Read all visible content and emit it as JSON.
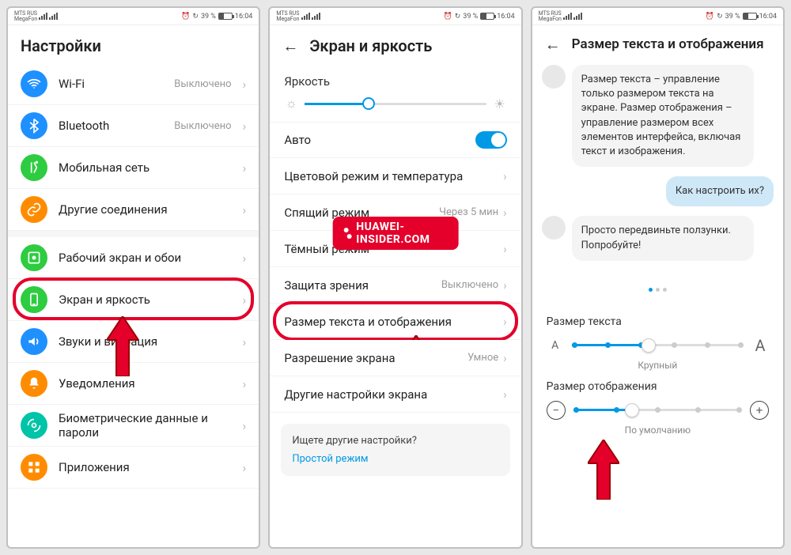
{
  "statusbar": {
    "carrier1": "MTS RUS",
    "carrier2": "MegaFon",
    "alarm": "⏰",
    "battery_pct": "39 %",
    "time": "16:04"
  },
  "watermark": "HUAWEI-INSIDER.COM",
  "screen1": {
    "title": "Настройки",
    "rows": [
      {
        "icon_color": "#1e90ff",
        "glyph": "wifi",
        "label": "Wi-Fi",
        "value": "Выключено"
      },
      {
        "icon_color": "#1e90ff",
        "glyph": "bt",
        "label": "Bluetooth",
        "value": "Выключено"
      },
      {
        "icon_color": "#2ecc40",
        "glyph": "cell",
        "label": "Мобильная сеть",
        "value": ""
      },
      {
        "icon_color": "#ff8c00",
        "glyph": "link",
        "label": "Другие соединения",
        "value": ""
      },
      {
        "gap": true
      },
      {
        "icon_color": "#2ecc40",
        "glyph": "home",
        "label": "Рабочий экран и обои",
        "value": ""
      },
      {
        "icon_color": "#2ecc40",
        "glyph": "display",
        "label": "Экран и яркость",
        "value": "",
        "highlight": true
      },
      {
        "icon_color": "#1e90ff",
        "glyph": "sound",
        "label": "Звуки и вибрация",
        "value": ""
      },
      {
        "icon_color": "#ff8c00",
        "glyph": "bell",
        "label": "Уведомления",
        "value": ""
      },
      {
        "icon_color": "#00c4a7",
        "glyph": "bio",
        "label": "Биометрические данные и пароли",
        "value": ""
      },
      {
        "icon_color": "#ff8c00",
        "glyph": "apps",
        "label": "Приложения",
        "value": ""
      }
    ]
  },
  "screen2": {
    "title": "Экран и яркость",
    "brightness_label": "Яркость",
    "auto_label": "Авто",
    "rows": [
      {
        "label": "Цветовой режим и температура",
        "value": ""
      },
      {
        "label": "Спящий режим",
        "value": "Через 5 мин"
      },
      {
        "label": "Тёмный режим",
        "value": "",
        "covered": true
      },
      {
        "label": "Защита зрения",
        "value": "Выключено"
      },
      {
        "label": "Размер текста и отображения",
        "value": "",
        "highlight": true
      },
      {
        "label": "Разрешение экрана",
        "value": "Умное"
      },
      {
        "label": "Другие настройки экрана",
        "value": ""
      }
    ],
    "help_q": "Ищете другие настройки?",
    "help_link": "Простой режим"
  },
  "screen3": {
    "title": "Размер текста и отображения",
    "msg1": "Размер текста – управление только размером текста на экране. Размер отображения – управление размером всех элементов интерфейса, включая текст и изображения.",
    "msg2": "Как настроить их?",
    "msg3": "Просто передвиньте ползунки. Попробуйте!",
    "text_size_label": "Размер текста",
    "text_size_caption": "Крупный",
    "display_size_label": "Размер отображения",
    "display_size_caption": "По умолчанию"
  }
}
